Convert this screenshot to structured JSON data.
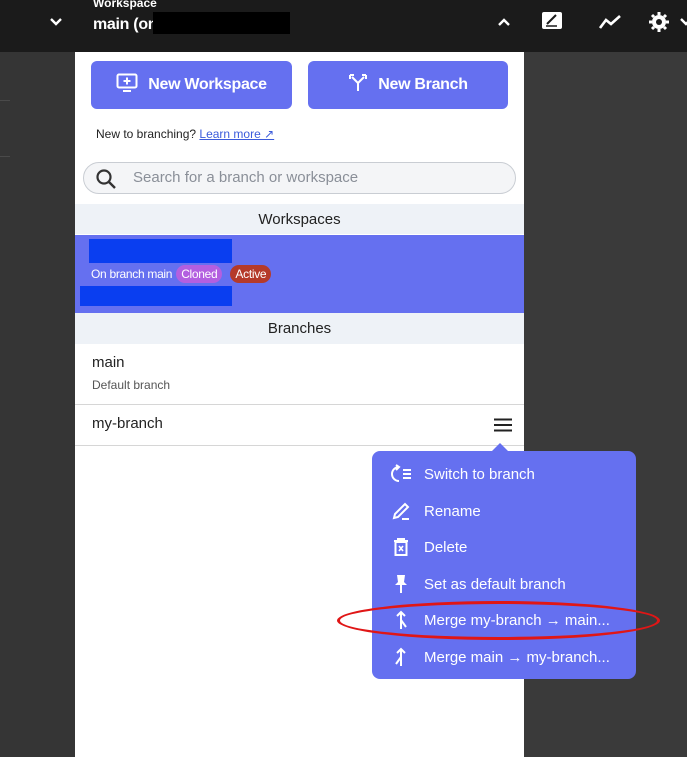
{
  "topbar": {
    "workspace_label": "Workspace",
    "workspace_name": "main (on",
    "icons": [
      "chevron-down-icon",
      "chevron-up-icon",
      "edit-note-icon",
      "trend-icon",
      "gear-icon"
    ]
  },
  "panel": {
    "new_workspace_label": "New Workspace",
    "new_branch_label": "New Branch",
    "new_to_text": "New to branching?",
    "learn_more": "Learn more ↗",
    "search_placeholder": "Search for a branch or workspace",
    "workspaces_heading": "Workspaces",
    "workspace": {
      "branch_text": "On branch main",
      "badge_cloned": "Cloned",
      "badge_active": "Active"
    },
    "branches_heading": "Branches",
    "branches": [
      {
        "name": "main",
        "sub": "Default branch"
      },
      {
        "name": "my-branch"
      }
    ]
  },
  "context_menu": {
    "items": [
      {
        "label": "Switch to branch",
        "icon": "switch-icon"
      },
      {
        "label": "Rename",
        "icon": "pencil-icon"
      },
      {
        "label": "Delete",
        "icon": "trash-icon"
      },
      {
        "label": "Set as default branch",
        "icon": "pin-icon"
      },
      {
        "label": "Merge my-branch → main...",
        "icon": "merge-icon"
      },
      {
        "label": "Merge main → my-branch...",
        "icon": "merge-icon"
      }
    ]
  },
  "colors": {
    "accent": "#6570f0",
    "highlight_oval": "#e01616"
  }
}
